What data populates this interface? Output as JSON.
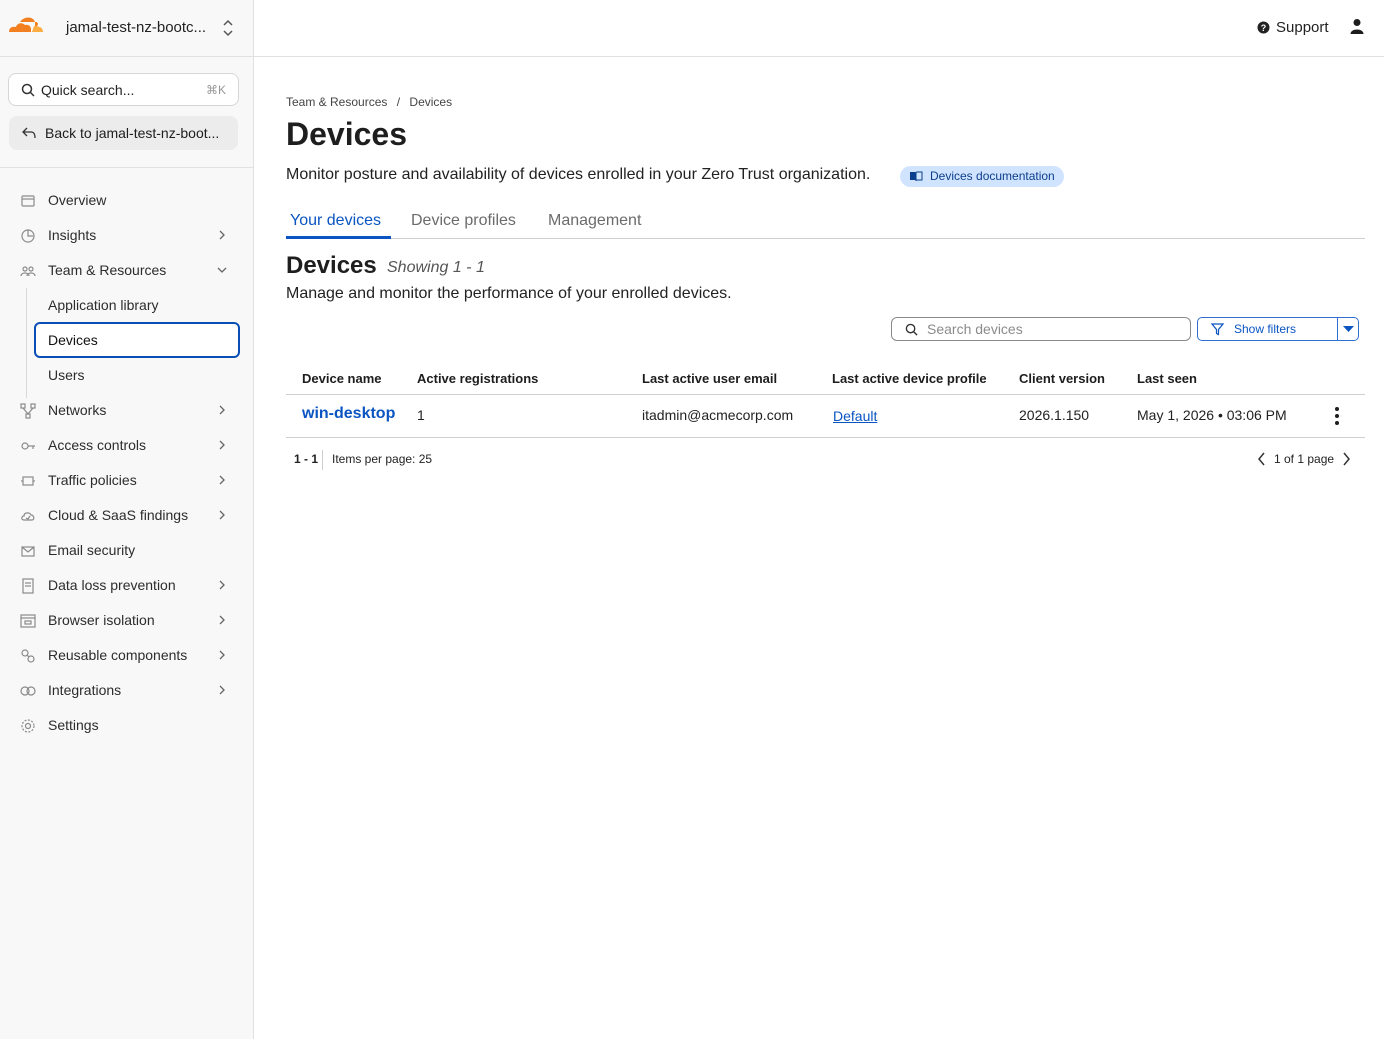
{
  "account": {
    "name": "jamal-test-nz-bootc..."
  },
  "search": {
    "label": "Quick search...",
    "shortcut": "⌘K"
  },
  "back": {
    "label": "Back to jamal-test-nz-boot..."
  },
  "sidebar": {
    "items": [
      {
        "label": "Overview",
        "icon": "overview-icon",
        "chevron": "none"
      },
      {
        "label": "Insights",
        "icon": "insights-icon",
        "chevron": "right"
      },
      {
        "label": "Team & Resources",
        "icon": "team-icon",
        "chevron": "down"
      },
      {
        "label": "Networks",
        "icon": "networks-icon",
        "chevron": "right"
      },
      {
        "label": "Access controls",
        "icon": "access-icon",
        "chevron": "right"
      },
      {
        "label": "Traffic policies",
        "icon": "traffic-icon",
        "chevron": "right"
      },
      {
        "label": "Cloud & SaaS findings",
        "icon": "cloud-icon",
        "chevron": "right"
      },
      {
        "label": "Email security",
        "icon": "email-icon",
        "chevron": "none"
      },
      {
        "label": "Data loss prevention",
        "icon": "dlp-icon",
        "chevron": "right"
      },
      {
        "label": "Browser isolation",
        "icon": "browser-icon",
        "chevron": "right"
      },
      {
        "label": "Reusable components",
        "icon": "components-icon",
        "chevron": "right"
      },
      {
        "label": "Integrations",
        "icon": "integrations-icon",
        "chevron": "right"
      },
      {
        "label": "Settings",
        "icon": "settings-icon",
        "chevron": "none"
      }
    ],
    "sub_items": [
      {
        "label": "Application library",
        "active": false
      },
      {
        "label": "Devices",
        "active": true
      },
      {
        "label": "Users",
        "active": false
      }
    ]
  },
  "topbar": {
    "support": "Support"
  },
  "breadcrumb": {
    "parent": "Team & Resources",
    "sep": "/",
    "current": "Devices"
  },
  "page": {
    "title": "Devices",
    "description": "Monitor posture and availability of devices enrolled in your Zero Trust organization.",
    "doc_link": "Devices documentation"
  },
  "tabs": [
    {
      "label": "Your devices",
      "active": true
    },
    {
      "label": "Device profiles",
      "active": false
    },
    {
      "label": "Management",
      "active": false
    }
  ],
  "section": {
    "title": "Devices",
    "count": "Showing 1 - 1",
    "description": "Manage and monitor the performance of your enrolled devices."
  },
  "device_search": {
    "placeholder": "Search devices"
  },
  "filters": {
    "label": "Show filters"
  },
  "table": {
    "columns": [
      "Device name",
      "Active registrations",
      "Last active user email",
      "Last active device profile",
      "Client version",
      "Last seen"
    ],
    "rows": [
      {
        "name": "win-desktop",
        "registrations": "1",
        "email": "itadmin@acmecorp.com",
        "profile": "Default",
        "version": "2026.1.150",
        "last_seen": "May 1, 2026 • 03:06 PM"
      }
    ]
  },
  "pagination": {
    "range": "1 - 1",
    "items_per_page": "Items per page: 25",
    "page_of": "1 of 1 page"
  },
  "colors": {
    "accent": "#0a55c2",
    "brand": "#f38020",
    "chip_bg": "#d0e4ff"
  }
}
